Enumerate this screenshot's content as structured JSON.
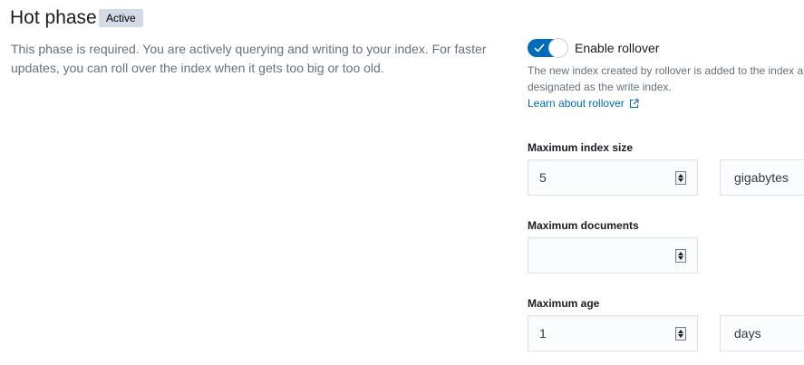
{
  "phase": {
    "title": "Hot phase",
    "badge": "Active",
    "description": "This phase is required. You are actively querying and writing to your index. For faster updates, you can roll over the index when it gets too big or too old."
  },
  "rollover": {
    "toggle_label": "Enable rollover",
    "enabled": true,
    "help_line1": "The new index created by rollover is added to the index alias and",
    "help_line2": "designated as the write index.",
    "learn_link": "Learn about rollover"
  },
  "fields": {
    "max_size": {
      "label": "Maximum index size",
      "value": "5",
      "unit": "gigabytes"
    },
    "max_docs": {
      "label": "Maximum documents",
      "value": ""
    },
    "max_age": {
      "label": "Maximum age",
      "value": "1",
      "unit": "days"
    }
  },
  "colors": {
    "accent": "#006bb8",
    "badge_bg": "#d3dae6",
    "muted_text": "#69707d"
  }
}
